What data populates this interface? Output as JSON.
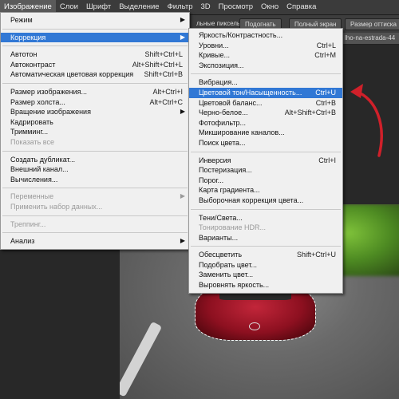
{
  "menubar": {
    "items": [
      {
        "label": "Изображение",
        "active": true
      },
      {
        "label": "Слои"
      },
      {
        "label": "Шрифт"
      },
      {
        "label": "Выделение"
      },
      {
        "label": "Фильтр"
      },
      {
        "label": "3D"
      },
      {
        "label": "Просмотр"
      },
      {
        "label": "Окно"
      },
      {
        "label": "Справка"
      }
    ]
  },
  "toolbar": {
    "pixels_label": "льные пикселы",
    "fit_label": "Подогнать",
    "fullscreen_label": "Полный экран",
    "print_size_label": "Размер оттиска"
  },
  "document_tab": {
    "label": "lho-na-estrada-44"
  },
  "main_menu": {
    "mode": {
      "label": "Режим"
    },
    "correction": {
      "label": "Коррекция"
    },
    "autotone": {
      "label": "Автотон",
      "shortcut": "Shift+Ctrl+L"
    },
    "autocontrast": {
      "label": "Автоконтраст",
      "shortcut": "Alt+Shift+Ctrl+L"
    },
    "autocolor": {
      "label": "Автоматическая цветовая коррекция",
      "shortcut": "Shift+Ctrl+B"
    },
    "image_size": {
      "label": "Размер изображения...",
      "shortcut": "Alt+Ctrl+I"
    },
    "canvas_size": {
      "label": "Размер холста...",
      "shortcut": "Alt+Ctrl+C"
    },
    "rotation": {
      "label": "Вращение изображения"
    },
    "crop": {
      "label": "Кадрировать"
    },
    "trim": {
      "label": "Тримминг..."
    },
    "reveal_all": {
      "label": "Показать все"
    },
    "duplicate": {
      "label": "Создать дубликат..."
    },
    "apply_image": {
      "label": "Внешний канал..."
    },
    "calculations": {
      "label": "Вычисления..."
    },
    "variables": {
      "label": "Переменные"
    },
    "apply_dataset": {
      "label": "Применить набор данных..."
    },
    "trapping": {
      "label": "Треппинг..."
    },
    "analysis": {
      "label": "Анализ"
    }
  },
  "sub_menu": {
    "brightness": {
      "label": "Яркость/Контрастность..."
    },
    "levels": {
      "label": "Уровни...",
      "shortcut": "Ctrl+L"
    },
    "curves": {
      "label": "Кривые...",
      "shortcut": "Ctrl+M"
    },
    "exposure": {
      "label": "Экспозиция..."
    },
    "vibrance": {
      "label": "Вибрация..."
    },
    "hue_saturation": {
      "label": "Цветовой тон/Насыщенность...",
      "shortcut": "Ctrl+U"
    },
    "color_balance": {
      "label": "Цветовой баланс...",
      "shortcut": "Ctrl+B"
    },
    "black_white": {
      "label": "Черно-белое...",
      "shortcut": "Alt+Shift+Ctrl+B"
    },
    "photo_filter": {
      "label": "Фотофильтр..."
    },
    "channel_mixer": {
      "label": "Микширование каналов..."
    },
    "color_lookup": {
      "label": "Поиск цвета..."
    },
    "invert": {
      "label": "Инверсия",
      "shortcut": "Ctrl+I"
    },
    "posterize": {
      "label": "Постеризация..."
    },
    "threshold": {
      "label": "Порог..."
    },
    "gradient_map": {
      "label": "Карта градиента..."
    },
    "selective_color": {
      "label": "Выборочная коррекция цвета..."
    },
    "shadows_highlights": {
      "label": "Тени/Света..."
    },
    "hdr_toning": {
      "label": "Тонирование HDR..."
    },
    "variations": {
      "label": "Варианты..."
    },
    "desaturate": {
      "label": "Обесцветить",
      "shortcut": "Shift+Ctrl+U"
    },
    "match_color": {
      "label": "Подобрать цвет..."
    },
    "replace_color": {
      "label": "Заменить цвет..."
    },
    "equalize": {
      "label": "Выровнять яркость..."
    }
  },
  "colors": {
    "highlight": "#3178d5",
    "annotation_arrow": "#d0202a",
    "car": "#b51c2e",
    "grass": "#6fb233"
  }
}
